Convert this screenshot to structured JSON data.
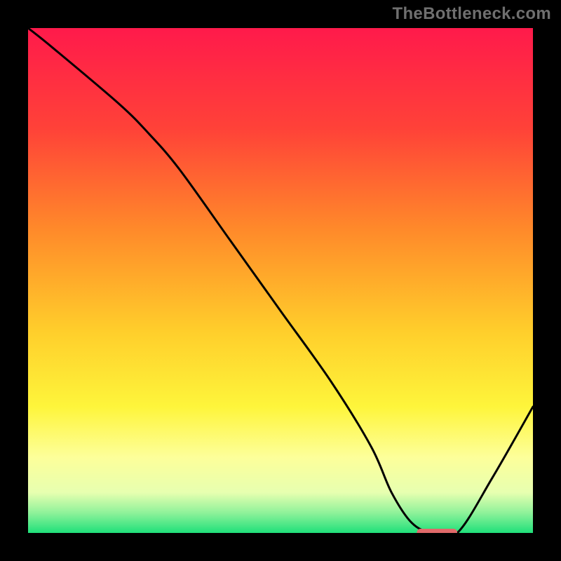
{
  "watermark": "TheBottleneck.com",
  "chart_data": {
    "type": "line",
    "title": "",
    "xlabel": "",
    "ylabel": "",
    "xlim": [
      0,
      100
    ],
    "ylim": [
      0,
      100
    ],
    "gradient_stops": [
      {
        "offset": 0,
        "color": "#ff1a4b"
      },
      {
        "offset": 20,
        "color": "#ff4238"
      },
      {
        "offset": 40,
        "color": "#ff8a2a"
      },
      {
        "offset": 60,
        "color": "#ffce2b"
      },
      {
        "offset": 75,
        "color": "#fef53b"
      },
      {
        "offset": 85,
        "color": "#fdff9a"
      },
      {
        "offset": 92,
        "color": "#e7ffb0"
      },
      {
        "offset": 96,
        "color": "#8ff29a"
      },
      {
        "offset": 100,
        "color": "#1fe07a"
      }
    ],
    "curve": {
      "name": "bottleneck-curve",
      "x": [
        0,
        5,
        18,
        24,
        30,
        40,
        50,
        60,
        68,
        72,
        76,
        80,
        85,
        92,
        100
      ],
      "y": [
        100,
        96,
        85,
        79,
        72,
        58,
        44,
        30,
        17,
        8,
        2,
        0,
        0,
        11,
        25
      ]
    },
    "optimal_marker": {
      "x_start": 77,
      "x_end": 85,
      "y": 0,
      "color": "#e06a6a"
    }
  }
}
